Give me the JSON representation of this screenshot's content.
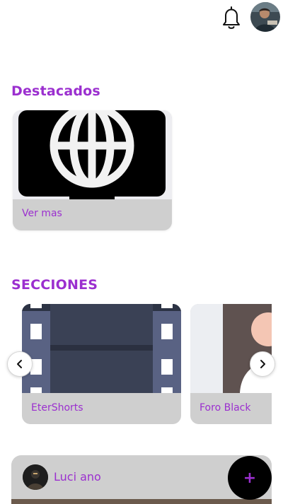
{
  "colors": {
    "accent": "#9b2fcf",
    "card_bg": "#cfcfcf",
    "fab_bg": "#000000"
  },
  "header": {
    "notification_icon": "bell-icon",
    "profile_avatar": "user-avatar"
  },
  "featured": {
    "title": "Destacados",
    "card": {
      "icon": "globe-icon",
      "link_label": "Ver mas"
    }
  },
  "sections": {
    "title": "SECCIONES",
    "items": [
      {
        "label": "EterShorts",
        "icon": "film-strip-icon"
      },
      {
        "label": "Foro Black",
        "icon": "person-silhouette-icon"
      }
    ],
    "prev_icon": "chevron-left-icon",
    "next_icon": "chevron-right-icon"
  },
  "post": {
    "author": "Luci ano"
  },
  "fab": {
    "label": "+"
  }
}
